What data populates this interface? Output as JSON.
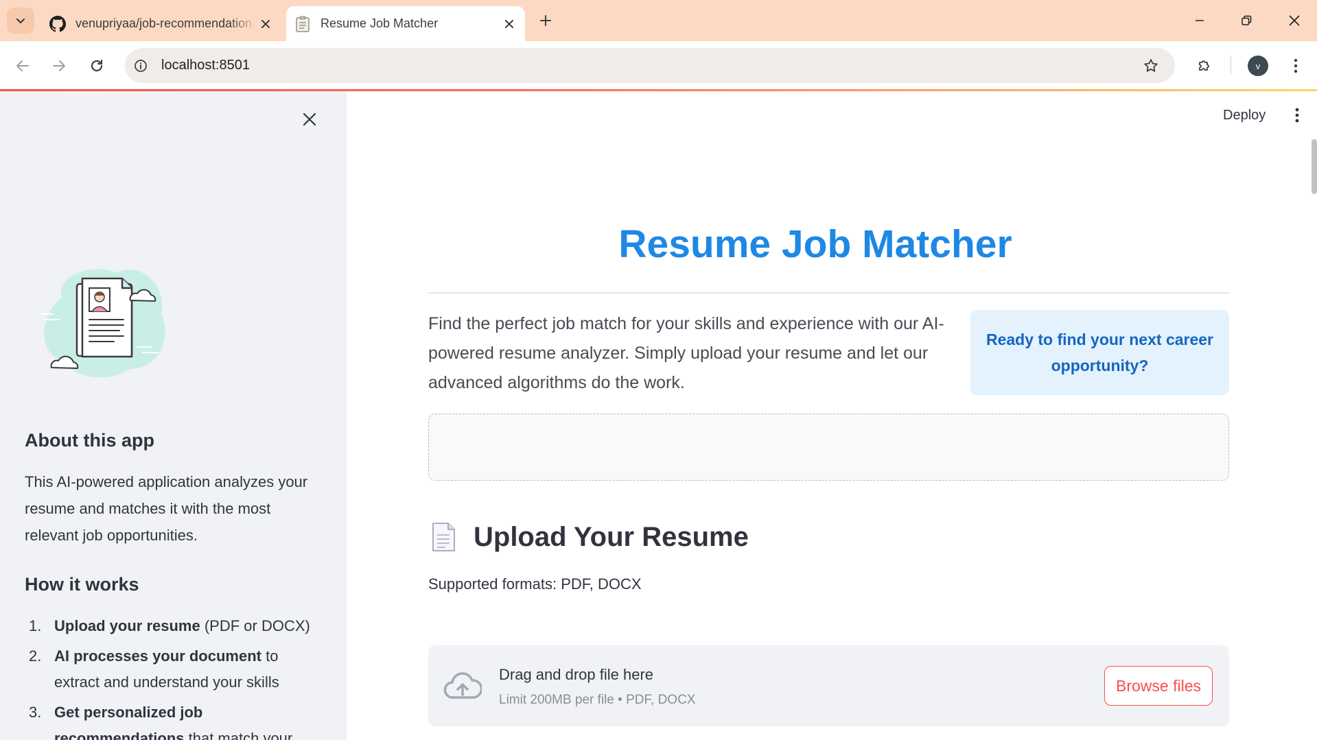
{
  "browser": {
    "tabs": [
      {
        "title": "venupriyaa/job-recommendation",
        "icon": "github-icon",
        "active": false
      },
      {
        "title": "Resume Job Matcher",
        "icon": "clipboard-icon",
        "active": true
      }
    ],
    "url": "localhost:8501",
    "profile_initial": "v"
  },
  "header": {
    "deploy_label": "Deploy"
  },
  "sidebar": {
    "about_title": "About this app",
    "about_text": "This AI-powered application analyzes your resume and matches it with the most relevant job opportunities.",
    "how_title": "How it works",
    "steps": [
      {
        "num": "1.",
        "bold": "Upload your resume",
        "rest": " (PDF or DOCX)"
      },
      {
        "num": "2.",
        "bold": "AI processes your document",
        "rest": " to extract and understand your skills"
      },
      {
        "num": "3.",
        "bold": "Get personalized job recommendations",
        "rest": " that match your"
      }
    ]
  },
  "main": {
    "title": "Resume Job Matcher",
    "intro": "Find the perfect job match for your skills and experience with our AI-powered resume analyzer. Simply upload your resume and let our advanced algorithms do the work.",
    "cta": "Ready to find your next career opportunity?",
    "upload": {
      "heading": "Upload Your Resume",
      "formats": "Supported formats: PDF, DOCX",
      "drop_title": "Drag and drop file here",
      "drop_limit": "Limit 200MB per file • PDF, DOCX",
      "browse_label": "Browse files"
    }
  },
  "colors": {
    "accent": "#1e88e5",
    "cta_bg": "#e3f2fd",
    "cta_text": "#1565c0",
    "browse": "#ff4b4b",
    "sidebar_bg": "#f0f2f6",
    "tabbar_bg": "#fcd9c2"
  }
}
